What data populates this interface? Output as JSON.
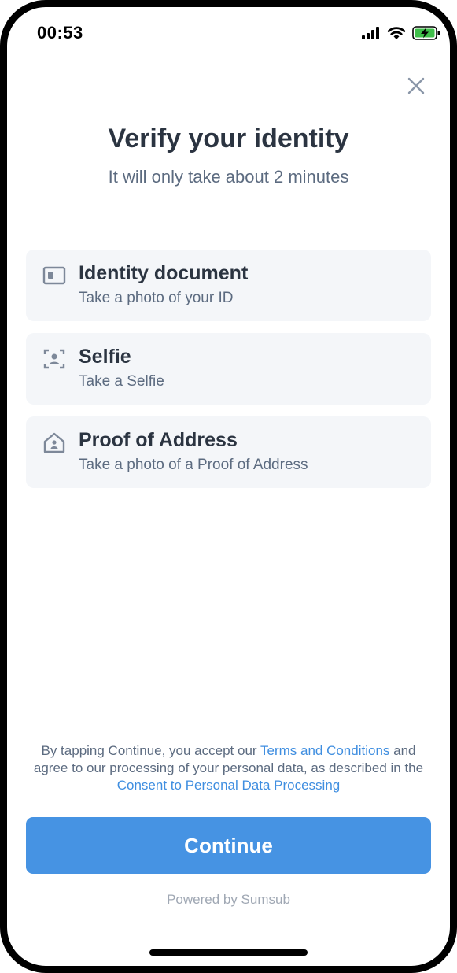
{
  "status_bar": {
    "time": "00:53",
    "icons": [
      "cellular-signal-icon",
      "wifi-icon",
      "battery-charging-icon"
    ]
  },
  "header": {
    "close_icon": "close-icon",
    "title": "Verify your identity",
    "subtitle": "It will only take about 2 minutes"
  },
  "steps": [
    {
      "icon": "id-card-icon",
      "title": "Identity document",
      "subtitle": "Take a photo of your ID"
    },
    {
      "icon": "selfie-icon",
      "title": "Selfie",
      "subtitle": "Take a Selfie"
    },
    {
      "icon": "house-icon",
      "title": "Proof of Address",
      "subtitle": "Take a photo of a Proof of Address"
    }
  ],
  "legal": {
    "text_before_terms": "By tapping Continue, you accept our ",
    "terms_link": "Terms and Conditions",
    "text_middle": " and agree to our processing of your personal data, as described in the ",
    "consent_link": "Consent to Personal Data Processing"
  },
  "actions": {
    "continue_label": "Continue"
  },
  "footer": {
    "powered_by": "Powered by Sumsub"
  },
  "colors": {
    "accent": "#4693e3",
    "link": "#3f8ee0",
    "title": "#2b3441",
    "muted": "#5c6b80",
    "card_bg": "#f4f6f9",
    "battery": "#3fbf4a"
  }
}
